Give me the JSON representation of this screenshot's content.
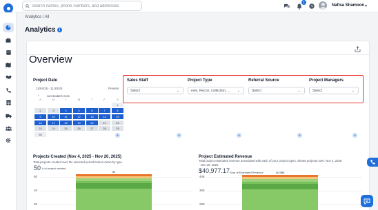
{
  "header": {
    "search_placeholder": "Search names, phone numbers, and addresses",
    "notification_count": "1",
    "user_name": "Nafisa Shamoon"
  },
  "breadcrumb": "Analytics / All",
  "page": {
    "title": "Analytics",
    "info_symbol": "i",
    "overview_title": "Overview"
  },
  "project_date": {
    "label": "Project Date",
    "range": "11/04/25 - 11/20/25",
    "presets": "Presets",
    "prev_symbol": "‹",
    "nav_symbol": "+",
    "month": "NOVEMBER 2025",
    "weekdays": [
      "S",
      "M",
      "T",
      "W",
      "T",
      "F",
      "S"
    ],
    "weeks": [
      [
        "",
        "",
        "",
        "",
        "",
        "",
        "1"
      ],
      [
        "2",
        "3",
        "4",
        "5",
        "6",
        "7",
        "8"
      ],
      [
        "9",
        "10",
        "11",
        "12",
        "13",
        "14",
        "15"
      ],
      [
        "16",
        "17",
        "18",
        "19",
        "20",
        "21",
        "22"
      ],
      [
        "23",
        "24",
        "25",
        "26",
        "27",
        "28",
        "29"
      ],
      [
        "30",
        "",
        "",
        "",
        "",
        "",
        ""
      ]
    ],
    "selected_days": [
      "4",
      "5",
      "6",
      "7",
      "8",
      "9",
      "10",
      "11",
      "12",
      "13",
      "14",
      "15",
      "16",
      "17",
      "18",
      "19",
      "20"
    ]
  },
  "filters": [
    {
      "label": "Sales Staff",
      "value": "Select"
    },
    {
      "label": "Project Type",
      "value": "evie, Recon, collection, ..."
    },
    {
      "label": "Referral Source",
      "value": "Select"
    },
    {
      "label": "Project Managers",
      "value": "Select"
    }
  ],
  "projects_created": {
    "title": "Projects Created (Nov 4, 2025 - Nov 20, 2025)",
    "subtitle": "Total projects created over the selected period broken down by type.",
    "total": "50",
    "total_caption": "# of project created"
  },
  "estimated_revenue": {
    "title": "Project Estimated Revenue",
    "subtitle_line1": "Total project estimated revenue associated with each of your project types. Shows projects over: Nov 4, 2025",
    "subtitle_line2": "- Nov 20, 2025.",
    "total": "$40,977.17",
    "total_caption": "Sum of Estimated Revenue"
  },
  "chart_data": [
    {
      "type": "bar",
      "stacked": true,
      "title": "Projects Created (Nov 4, 2025 - Nov 20, 2025)",
      "y_ticks": [
        "50",
        "40",
        "30"
      ],
      "ylim": [
        20,
        52
      ],
      "bar_label": "50",
      "value": 50,
      "segment_colors": [
        "#e8752c",
        "#f4c47a",
        "#9fd178",
        "#78c25b",
        "#5aa946",
        "#86c966"
      ]
    },
    {
      "type": "bar",
      "stacked": true,
      "title": "Project Estimated Revenue",
      "y_ticks": [
        "40K",
        "30K",
        "20K"
      ],
      "ylim": [
        15000,
        43000
      ],
      "bar_label": "40.98K",
      "value": 40977.17,
      "segment_colors": [
        "#e8752c",
        "#f4c47a",
        "#9fd178",
        "#78c25b",
        "#5aa946",
        "#86c966"
      ]
    }
  ]
}
